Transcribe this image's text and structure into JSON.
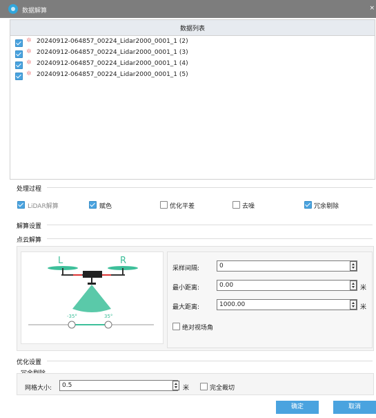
{
  "window": {
    "title": "数据解算"
  },
  "data_list": {
    "header": "数据列表",
    "items": [
      "20240912-064857_00224_Lidar2000_0001_1 (2)",
      "20240912-064857_00224_Lidar2000_0001_1 (3)",
      "20240912-064857_00224_Lidar2000_0001_1 (4)",
      "20240912-064857_00224_Lidar2000_0001_1 (5)"
    ]
  },
  "process": {
    "title": "处理过程",
    "options": [
      {
        "label": "LiDAR解算",
        "checked": true,
        "disabled": true
      },
      {
        "label": "赋色",
        "checked": true,
        "disabled": false
      },
      {
        "label": "优化平差",
        "checked": false,
        "disabled": false
      },
      {
        "label": "去噪",
        "checked": false,
        "disabled": false
      },
      {
        "label": "冗余剔除",
        "checked": true,
        "disabled": false
      }
    ]
  },
  "solve": {
    "title": "解算设置",
    "subtitle": "点云解算",
    "diagram": {
      "left_label": "L",
      "right_label": "R",
      "angle_left": "-35°",
      "angle_right": "35°"
    },
    "params": {
      "sample_label": "采样间隔:",
      "sample_value": "0",
      "min_label": "最小距离:",
      "min_value": "0.00",
      "min_unit": "米",
      "max_label": "最大距离:",
      "max_value": "1000.00",
      "max_unit": "米",
      "absolute_fov_label": "绝对视场角"
    }
  },
  "optimize": {
    "title": "优化设置",
    "subtitle": "冗余剔除",
    "grid_label": "网格大小:",
    "grid_value": "0.5",
    "grid_unit": "米",
    "full_crop_label": "完全裁切"
  },
  "buttons": {
    "ok": "确定",
    "cancel": "取消"
  },
  "colors": {
    "accent": "#4aa3df",
    "titlebar": "#7d7d7d",
    "diagram_green": "#3dbf9a"
  }
}
